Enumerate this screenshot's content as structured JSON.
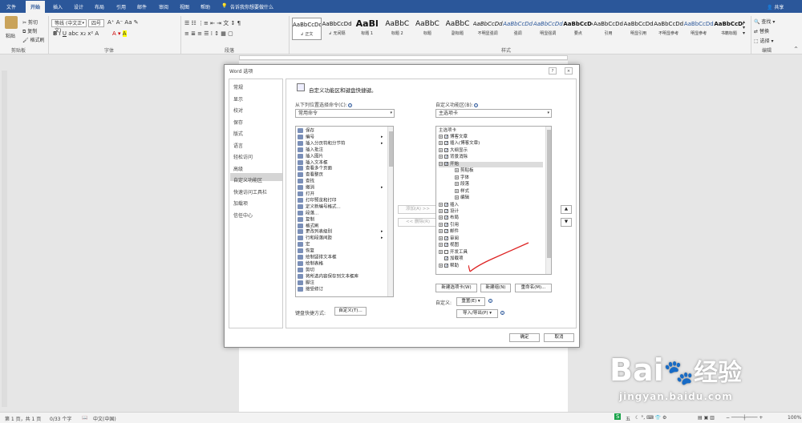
{
  "tabs": [
    "文件",
    "开始",
    "插入",
    "设计",
    "布局",
    "引用",
    "邮件",
    "审阅",
    "视图",
    "帮助"
  ],
  "active_tab": "开始",
  "tell_me": "告诉我你想要做什么",
  "share": "共享",
  "clipboard": {
    "paste": "粘贴",
    "cut": "剪切",
    "copy": "复制",
    "format_painter": "格式刷",
    "group": "剪贴板"
  },
  "font": {
    "name": "等线 (中文正文)",
    "size": "四号",
    "group": "字体"
  },
  "paragraph": {
    "group": "段落"
  },
  "styles": {
    "group": "样式",
    "items": [
      {
        "sample": "AaBbCcDd",
        "name": "↲ 正文"
      },
      {
        "sample": "AaBbCcDd",
        "name": "↲ 无间隔"
      },
      {
        "sample": "AaBl",
        "name": "标题 1"
      },
      {
        "sample": "AaBbC",
        "name": "标题 2"
      },
      {
        "sample": "AaBbC",
        "name": "标题"
      },
      {
        "sample": "AaBbC",
        "name": "副标题"
      },
      {
        "sample": "AaBbCcDd",
        "name": "不明显强调"
      },
      {
        "sample": "AaBbCcDd",
        "name": "强调"
      },
      {
        "sample": "AaBbCcDd",
        "name": "明显强调"
      },
      {
        "sample": "AaBbCcDd",
        "name": "要点"
      },
      {
        "sample": "AaBbCcDd",
        "name": "引用"
      },
      {
        "sample": "AaBbCcDd",
        "name": "明显引用"
      },
      {
        "sample": "AaBbCcDd",
        "name": "不明显参考"
      },
      {
        "sample": "AaBbCcDd",
        "name": "明显参考"
      },
      {
        "sample": "AaBbCcDd",
        "name": "书籍标题"
      }
    ]
  },
  "editing": {
    "find": "查找",
    "replace": "替换",
    "select": "选择",
    "group": "编辑"
  },
  "dialog": {
    "title": "Word 选项",
    "nav": [
      "常规",
      "显示",
      "校对",
      "保存",
      "版式",
      "语言",
      "轻松访问",
      "高级",
      "自定义功能区",
      "快速访问工具栏",
      "加载项",
      "信任中心"
    ],
    "selected_nav": "自定义功能区",
    "header": "自定义功能区和键盘快捷键。",
    "choose_label": "从下列位置选择命令(C):",
    "choose_value": "常用命令",
    "customize_label": "自定义功能区(B):",
    "customize_value": "主选项卡",
    "commands": [
      "保存",
      "编号",
      "插入分页符和分节符",
      "插入批注",
      "插入图片",
      "插入文本框",
      "查看多个页面",
      "查看整页",
      "查找",
      "撤消",
      "打开",
      "打印预览和打印",
      "定义新编号格式...",
      "段落...",
      "复制",
      "格式刷",
      "更改列表级别",
      "行和段落间距",
      "宏",
      "恢复",
      "绘制竖排文本框",
      "绘制表格",
      "剪切",
      "将所选内容保存到文本框库",
      "脚注",
      "接受修订"
    ],
    "add_btn": "添加(A) >>",
    "remove_btn": "<< 删除(R)",
    "tree_header": "主选项卡",
    "tree": [
      {
        "label": "博客文章",
        "indent": 0,
        "ex": "+",
        "checked": true
      },
      {
        "label": "插入(博客文章)",
        "indent": 0,
        "ex": "+",
        "checked": true
      },
      {
        "label": "大纲显示",
        "indent": 0,
        "ex": "+",
        "checked": true
      },
      {
        "label": "背景消除",
        "indent": 0,
        "ex": "+",
        "checked": true
      },
      {
        "label": "开始",
        "indent": 0,
        "ex": "−",
        "checked": true
      },
      {
        "label": "剪贴板",
        "indent": 1,
        "ex": "+",
        "checked": null
      },
      {
        "label": "字体",
        "indent": 1,
        "ex": "+",
        "checked": null
      },
      {
        "label": "段落",
        "indent": 1,
        "ex": "+",
        "checked": null
      },
      {
        "label": "样式",
        "indent": 1,
        "ex": "+",
        "checked": null
      },
      {
        "label": "编辑",
        "indent": 1,
        "ex": "+",
        "checked": null
      },
      {
        "label": "插入",
        "indent": 0,
        "ex": "+",
        "checked": true
      },
      {
        "label": "设计",
        "indent": 0,
        "ex": "+",
        "checked": true
      },
      {
        "label": "布局",
        "indent": 0,
        "ex": "+",
        "checked": true
      },
      {
        "label": "引用",
        "indent": 0,
        "ex": "+",
        "checked": true
      },
      {
        "label": "邮件",
        "indent": 0,
        "ex": "+",
        "checked": true
      },
      {
        "label": "审阅",
        "indent": 0,
        "ex": "+",
        "checked": true
      },
      {
        "label": "视图",
        "indent": 0,
        "ex": "+",
        "checked": true
      },
      {
        "label": "开发工具",
        "indent": 0,
        "ex": "+",
        "checked": false
      },
      {
        "label": "加载项",
        "indent": 0,
        "ex": "",
        "checked": true
      },
      {
        "label": "帮助",
        "indent": 0,
        "ex": "+",
        "checked": true
      }
    ],
    "new_tab": "新建选项卡(W)",
    "new_group": "新建组(N)",
    "rename": "重命名(M)...",
    "custom_label": "自定义:",
    "reset": "重置(E) ▾",
    "import_export": "导入/导出(P) ▾",
    "shortcut_label": "键盘快捷方式:",
    "shortcut_btn": "自定义(T)...",
    "ok": "确定",
    "cancel": "取消",
    "title_btns": [
      "?",
      "×"
    ]
  },
  "status": {
    "page": "第 1 页，共 1 页",
    "words": "0/33 个字",
    "lang": "中文(中国)",
    "zoom": "100%"
  },
  "watermark": {
    "brand": "Bai",
    "brand_cn": "经验",
    "url": "jingyan.baidu.com"
  },
  "ime": "五"
}
